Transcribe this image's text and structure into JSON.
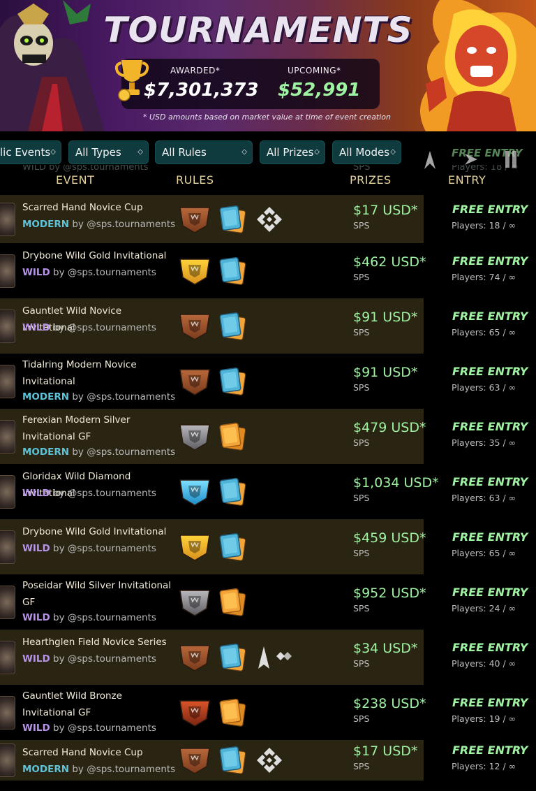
{
  "banner": {
    "title": "TOURNAMENTS",
    "awarded_label": "AWARDED*",
    "awarded_value": "$7,301,373",
    "upcoming_label": "UPCOMING*",
    "upcoming_value": "$52,991",
    "disclaimer": "* USD amounts based on market value at time of event creation",
    "colors": {
      "awarded": "#ffffff",
      "upcoming": "#9ef2a1"
    }
  },
  "filters": [
    {
      "label": "lic Events",
      "icon": "chevron-updown-icon"
    },
    {
      "label": "All Types",
      "icon": "chevron-updown-icon"
    },
    {
      "label": "All Rules",
      "icon": "chevron-updown-icon"
    },
    {
      "label": "All Prizes",
      "icon": "chevron-updown-icon"
    },
    {
      "label": "All Modes",
      "icon": "chevron-updown-icon"
    }
  ],
  "ghost_row": {
    "meta": "WILD by @sps.tournaments",
    "entry": "FREE ENTRY",
    "players": "Players: 18 / ∞",
    "currency": "SPS"
  },
  "headers": {
    "event": "EVENT",
    "rules": "RULES",
    "prizes": "PRIZES",
    "entry": "ENTRY"
  },
  "rows": [
    {
      "name": "Scarred Hand Novice Cup",
      "format": "MODERN",
      "by": "by @sps.tournaments",
      "league": "novice",
      "deck": "blue",
      "extra": "binance",
      "prize": "$17 USD*",
      "currency": "SPS",
      "entry": "FREE ENTRY",
      "players": "Players: 18 / ∞"
    },
    {
      "name": "Drybone Wild Gold Invitational",
      "format": "WILD",
      "by": "by @sps.tournaments",
      "league": "gold",
      "deck": "blue",
      "extra": "",
      "prize": "$462 USD*",
      "currency": "SPS",
      "entry": "FREE ENTRY",
      "players": "Players: 74 / ∞"
    },
    {
      "name": "Gauntlet Wild Novice Invitational",
      "format": "WILD",
      "by": "by @sps.tournaments",
      "league": "novice",
      "deck": "blue",
      "extra": "",
      "prize": "$91 USD*",
      "currency": "SPS",
      "entry": "FREE ENTRY",
      "players": "Players: 65 / ∞"
    },
    {
      "name": "Tidalring Modern Novice Invitational",
      "format": "MODERN",
      "by": "by @sps.tournaments",
      "league": "novice",
      "deck": "blue",
      "extra": "",
      "prize": "$91 USD*",
      "currency": "SPS",
      "entry": "FREE ENTRY",
      "players": "Players: 63 / ∞"
    },
    {
      "name": "Ferexian Modern Silver Invitational GF",
      "format": "MODERN",
      "by": "by @sps.tournaments",
      "league": "silver",
      "deck": "orange",
      "extra": "",
      "prize": "$479 USD*",
      "currency": "SPS",
      "entry": "FREE ENTRY",
      "players": "Players: 35 / ∞"
    },
    {
      "name": "Gloridax Wild Diamond Invitational",
      "format": "WILD",
      "by": "by @sps.tournaments",
      "league": "diamond",
      "deck": "blue",
      "extra": "",
      "prize": "$1,034 USD*",
      "currency": "SPS",
      "entry": "FREE ENTRY",
      "players": "Players: 63 / ∞"
    },
    {
      "name": "Drybone Wild Gold Invitational",
      "format": "WILD",
      "by": "by @sps.tournaments",
      "league": "gold",
      "deck": "blue",
      "extra": "",
      "prize": "$459 USD*",
      "currency": "SPS",
      "entry": "FREE ENTRY",
      "players": "Players: 65 / ∞"
    },
    {
      "name": "Poseidar Wild Silver Invitational GF",
      "format": "WILD",
      "by": "by @sps.tournaments",
      "league": "silver",
      "deck": "orange",
      "extra": "",
      "prize": "$952 USD*",
      "currency": "SPS",
      "entry": "FREE ENTRY",
      "players": "Players: 24 / ∞"
    },
    {
      "name": "Hearthglen Field Novice Series",
      "format": "WILD",
      "by": "by @sps.tournaments",
      "league": "novice",
      "deck": "blue",
      "extra": "arrow-diamond",
      "prize": "$34 USD*",
      "currency": "SPS",
      "entry": "FREE ENTRY",
      "players": "Players: 40 / ∞"
    },
    {
      "name": "Gauntlet Wild Bronze Invitational GF",
      "format": "WILD",
      "by": "by @sps.tournaments",
      "league": "bronze",
      "deck": "orange",
      "extra": "",
      "prize": "$238 USD*",
      "currency": "SPS",
      "entry": "FREE ENTRY",
      "players": "Players: 19 / ∞"
    },
    {
      "name": "Scarred Hand Novice Cup",
      "format": "MODERN",
      "by": "by @sps.tournaments",
      "league": "novice",
      "deck": "blue",
      "extra": "binance",
      "prize": "$17 USD*",
      "currency": "SPS",
      "entry": "FREE ENTRY",
      "players": "Players: 12 / ∞"
    }
  ]
}
